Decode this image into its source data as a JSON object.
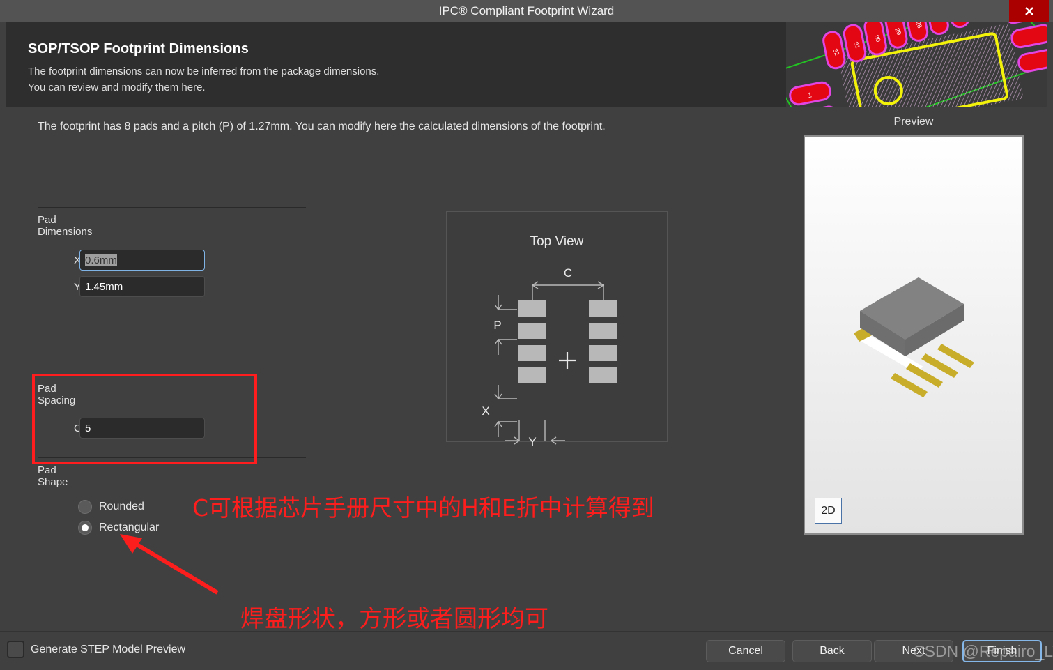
{
  "window": {
    "title": "IPC® Compliant Footprint Wizard",
    "close_icon": "close-icon"
  },
  "header": {
    "title": "SOP/TSOP Footprint Dimensions",
    "line1": "The footprint dimensions can now be inferred from the package dimensions.",
    "line2": "You can review and modify them here."
  },
  "main": {
    "intro": "The footprint has 8 pads and a pitch (P) of 1.27mm. You can modify here the calculated dimensions of the footprint.",
    "pad_dimensions": {
      "title": "Pad Dimensions",
      "x_label": "X",
      "x_value": "0.6mm",
      "y_label": "Y",
      "y_value": "1.45mm"
    },
    "pad_spacing": {
      "title": "Pad Spacing",
      "c_label": "C",
      "c_value": "5"
    },
    "pad_shape": {
      "title": "Pad Shape",
      "options": [
        {
          "label": "Rounded",
          "selected": false
        },
        {
          "label": "Rectangular",
          "selected": true
        }
      ]
    }
  },
  "diagram": {
    "title": "Top View",
    "labels": {
      "c": "C",
      "p": "P",
      "x": "X",
      "y": "Y"
    }
  },
  "preview": {
    "label": "Preview",
    "view_toggle": "2D"
  },
  "footer": {
    "checkbox_label": "Generate STEP Model Preview",
    "checkbox_checked": false,
    "buttons": [
      {
        "name": "cancel",
        "label": "Cancel",
        "default": false
      },
      {
        "name": "back",
        "label": "Back",
        "default": false,
        "mnemonic": "B"
      },
      {
        "name": "next",
        "label": "Next",
        "default": false,
        "mnemonic": "N"
      },
      {
        "name": "finish",
        "label": "Finish",
        "default": true,
        "mnemonic": "F"
      }
    ]
  },
  "annotations": {
    "note_c": "C可根据芯片手册尺寸中的H和E折中计算得到",
    "note_shape": "焊盘形状，方形或者圆形均可",
    "highlight_color": "#ff1d1d"
  },
  "watermark": "CSDN @Repairo_LYS"
}
